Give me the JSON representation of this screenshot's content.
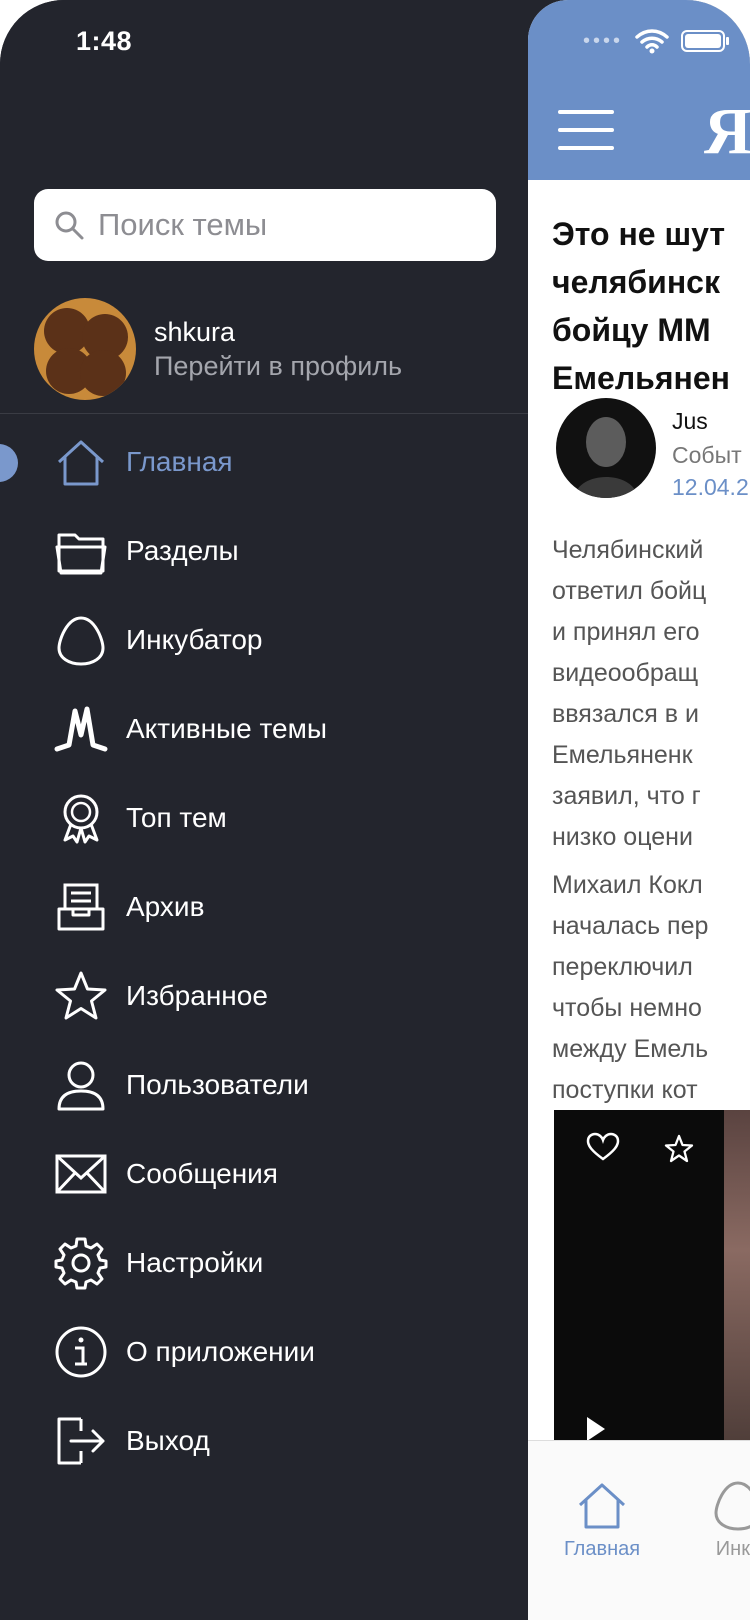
{
  "status": {
    "time": "1:48"
  },
  "search": {
    "placeholder": "Поиск темы"
  },
  "profile": {
    "username": "shkura",
    "link_label": "Перейти в профиль"
  },
  "menu": {
    "items": [
      {
        "label": "Главная",
        "icon": "home-icon",
        "active": true
      },
      {
        "label": "Разделы",
        "icon": "folder-icon"
      },
      {
        "label": "Инкубатор",
        "icon": "egg-icon"
      },
      {
        "label": "Активные темы",
        "icon": "activity-icon"
      },
      {
        "label": "Топ тем",
        "icon": "award-icon"
      },
      {
        "label": "Архив",
        "icon": "archive-icon"
      },
      {
        "label": "Избранное",
        "icon": "star-icon"
      },
      {
        "label": "Пользователи",
        "icon": "user-icon"
      },
      {
        "label": "Сообщения",
        "icon": "mail-icon"
      },
      {
        "label": "Настройки",
        "icon": "gear-icon"
      },
      {
        "label": "О приложении",
        "icon": "info-icon"
      },
      {
        "label": "Выход",
        "icon": "logout-icon"
      }
    ]
  },
  "main": {
    "brand": "Я",
    "article": {
      "title_lines": [
        "Это не шут",
        "челябинск",
        "бойцу ММ",
        "Емельянен"
      ],
      "author": {
        "name": "Jus",
        "category": "Событ",
        "date": "12.04.2"
      },
      "paragraph1": [
        "Челябинский",
        "ответил бойц",
        "и принял его",
        "видеообращ",
        "ввязался в и",
        "Емельяненк",
        "заявил, что г",
        "низко оцени"
      ],
      "paragraph2": [
        "Михаил Кокл",
        "началась пер",
        "переключил",
        "чтобы немно",
        "между Емель",
        "поступки кот"
      ]
    },
    "tabbar": {
      "home_label": "Главная",
      "incubator_label": "Инку"
    }
  },
  "colors": {
    "drawer_bg": "#23252d",
    "accent": "#7a98cc",
    "topbar": "#6b8fc7"
  }
}
